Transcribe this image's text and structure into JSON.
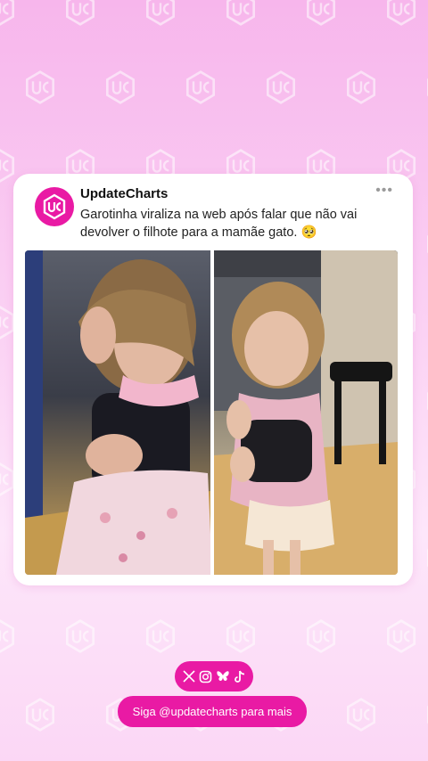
{
  "post": {
    "account_name": "UpdateCharts",
    "text": "Garotinha viraliza na web após falar que não vai devolver o filhote para a mamãe gato. 🥺",
    "avatar_icon": "uc-logo-icon",
    "more_icon": "more-options-icon"
  },
  "media": {
    "photos": [
      "girl-covering-face-holding-kitten",
      "girl-holding-kitten-in-kitchen"
    ]
  },
  "footer": {
    "social_icons": [
      "x-icon",
      "instagram-icon",
      "bluesky-icon",
      "tiktok-icon"
    ],
    "follow_text": "Siga @updatecharts para mais"
  },
  "colors": {
    "brand_pink": "#e91aa4",
    "background_top": "#f7b6ec",
    "background_bottom": "#fde6fa"
  }
}
